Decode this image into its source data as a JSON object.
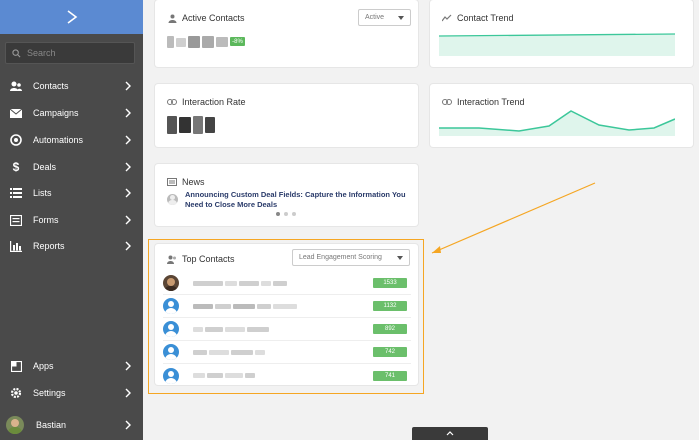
{
  "sidebar": {
    "search_placeholder": "Search",
    "items": [
      {
        "label": "Contacts",
        "icon": "contacts-icon"
      },
      {
        "label": "Campaigns",
        "icon": "envelope-icon"
      },
      {
        "label": "Automations",
        "icon": "automation-icon"
      },
      {
        "label": "Deals",
        "icon": "dollar-icon"
      },
      {
        "label": "Lists",
        "icon": "list-icon"
      },
      {
        "label": "Forms",
        "icon": "form-icon"
      },
      {
        "label": "Reports",
        "icon": "bar-chart-icon"
      }
    ],
    "apps_label": "Apps",
    "settings_label": "Settings",
    "user_name": "Bastian"
  },
  "cards": {
    "active_contacts": {
      "title": "Active Contacts",
      "filter": "Active",
      "change_badge": "-8%"
    },
    "contact_trend": {
      "title": "Contact Trend"
    },
    "interaction_rate": {
      "title": "Interaction Rate"
    },
    "interaction_trend": {
      "title": "Interaction Trend"
    },
    "news": {
      "title": "News",
      "headline": "Announcing Custom Deal Fields: Capture the Information You Need to Close More Deals"
    },
    "top_contacts": {
      "title": "Top Contacts",
      "sort": "Lead Engagement Scoring",
      "scores": [
        "1533",
        "1132",
        "892",
        "742",
        "741"
      ]
    }
  },
  "colors": {
    "sidebar_bg": "#4a4a4a",
    "logo_bar": "#5b8ad2",
    "trend_line": "#3cc79a",
    "trend_fill": "#dff5ec",
    "highlight": "#f5a623",
    "score_badge": "#6bbf6b"
  }
}
